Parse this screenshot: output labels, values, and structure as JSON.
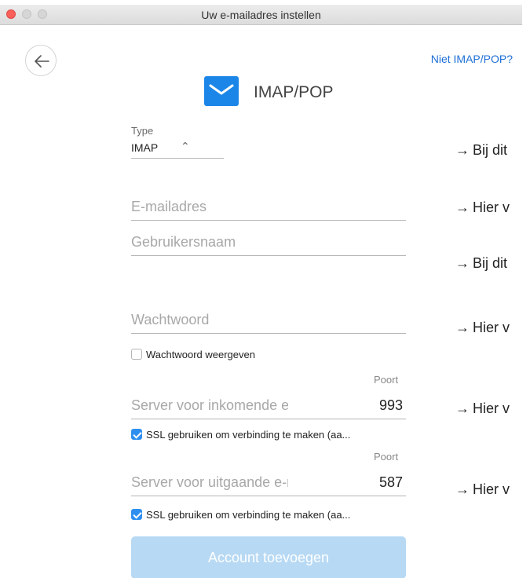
{
  "window": {
    "title": "Uw e-mailadres instellen"
  },
  "header": {
    "not_imap_link": "Niet IMAP/POP?",
    "heading": "IMAP/POP"
  },
  "form": {
    "type_label": "Type",
    "type_value": "IMAP",
    "email_placeholder": "E-mailadres",
    "username_placeholder": "Gebruikersnaam",
    "password_placeholder": "Wachtwoord",
    "show_password_label": "Wachtwoord weergeven",
    "port_label": "Poort",
    "incoming_placeholder": "Server voor inkomende e-mail",
    "incoming_port": "993",
    "incoming_ssl_label": "SSL gebruiken om verbinding te maken (aa...",
    "outgoing_placeholder": "Server voor uitgaande e-mail",
    "outgoing_port": "587",
    "outgoing_ssl_label": "SSL gebruiken om verbinding te maken (aa...",
    "submit_label": "Account toevoegen"
  },
  "annotations": [
    {
      "text": "Bij dit"
    },
    {
      "text": "Hier v"
    },
    {
      "text": "Bij dit"
    },
    {
      "text": "Hier v"
    },
    {
      "text": "Hier v"
    },
    {
      "text": "Hier v"
    }
  ],
  "colors": {
    "accent": "#1d6fd6",
    "icon_blue": "#1c86e8",
    "button_disabled": "#b7d9f4",
    "close_red": "#fc605b"
  }
}
